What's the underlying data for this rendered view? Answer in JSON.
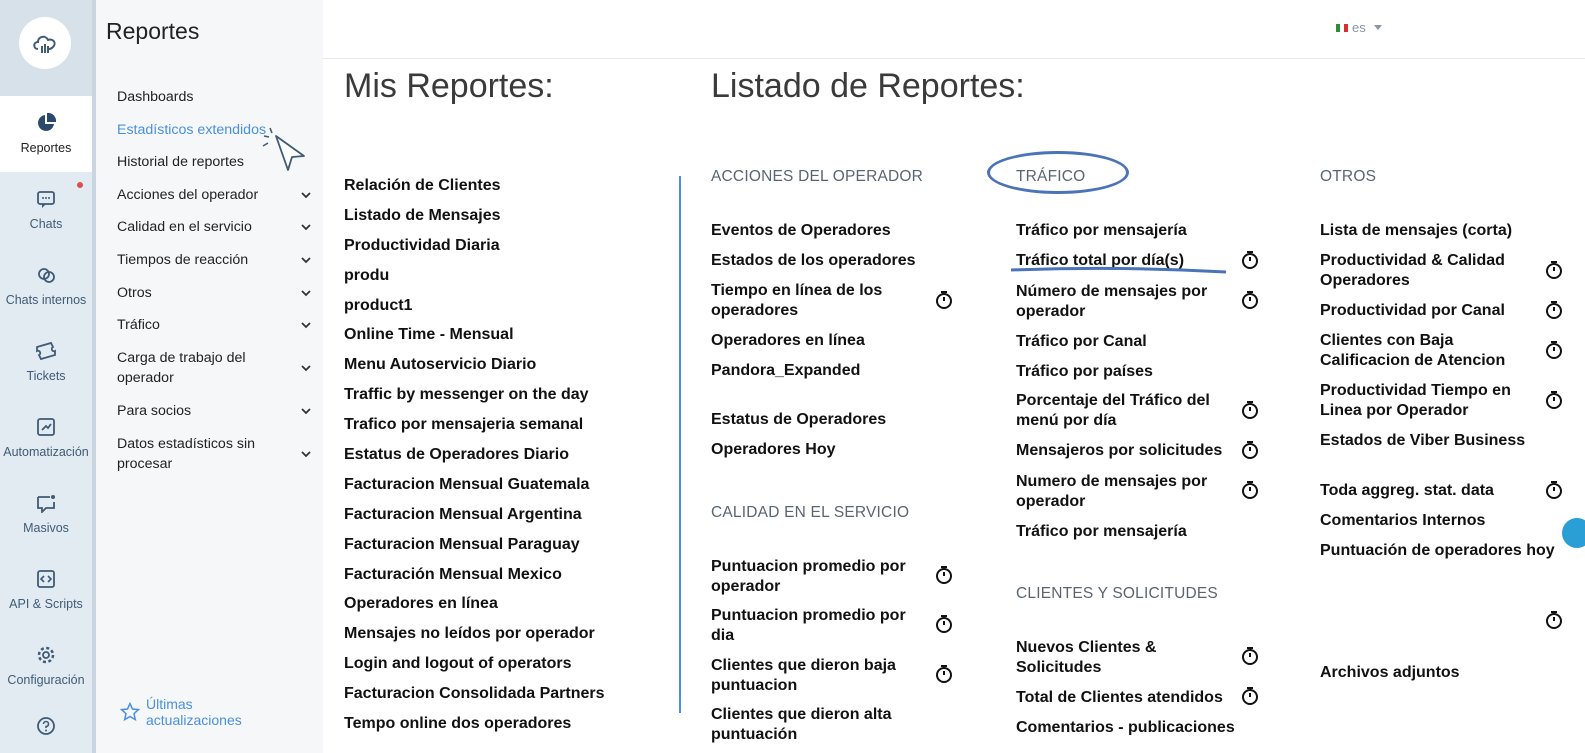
{
  "rail": {
    "items": [
      {
        "label": "Reportes",
        "icon": "pie-chart-icon"
      },
      {
        "label": "Chats",
        "icon": "chat-icon"
      },
      {
        "label": "Chats internos",
        "icon": "internal-chats-icon"
      },
      {
        "label": "Tickets",
        "icon": "ticket-icon"
      },
      {
        "label": "Automatización",
        "icon": "automation-icon"
      },
      {
        "label": "Masivos",
        "icon": "broadcast-icon"
      },
      {
        "label": "API & Scripts",
        "icon": "code-icon"
      },
      {
        "label": "Configuración",
        "icon": "gear-icon"
      }
    ]
  },
  "sidebar": {
    "title": "Reportes",
    "items": [
      {
        "label": "Dashboards"
      },
      {
        "label": "Estadísticos extendidos"
      },
      {
        "label": "Historial de reportes"
      },
      {
        "label": "Acciones del operador"
      },
      {
        "label": "Calidad en el servicio"
      },
      {
        "label": "Tiempos de reacción"
      },
      {
        "label": "Otros"
      },
      {
        "label": "Tráfico"
      },
      {
        "label": "Carga de trabajo del operador"
      },
      {
        "label": "Para socios"
      },
      {
        "label": "Datos estadísticos sin procesar"
      }
    ],
    "updates_label": "Últimas actualizaciones"
  },
  "header": {
    "language": "es"
  },
  "mis_reportes": {
    "title": "Mis Reportes:",
    "items": [
      "Relación de Clientes",
      "Listado de Mensajes",
      "Productividad Diaria",
      "produ",
      "product1",
      "Online Time - Mensual",
      "Menu Autoservicio Diario",
      "Traffic by messenger on the day",
      "Trafico por mensajeria semanal",
      "Estatus de Operadores Diario",
      "Facturacion Mensual Guatemala",
      "Facturacion Mensual Argentina",
      "Facturacion Mensual Paraguay",
      "Facturación Mensual Mexico",
      "Operadores en línea",
      "Mensajes no leídos por operador",
      "Login and logout of operators",
      "Facturacion Consolidada Partners",
      "Tempo online dos operadores"
    ]
  },
  "listado": {
    "title": "Listado de Reportes:",
    "acciones": {
      "heading": "ACCIONES DEL OPERADOR",
      "items": [
        "Eventos de Operadores",
        "Estados de los operadores",
        "Tiempo en línea de los operadores",
        "Operadores en línea",
        "Pandora_Expanded",
        "Estatus de Operadores",
        "Operadores Hoy"
      ]
    },
    "calidad": {
      "heading": "CALIDAD EN EL SERVICIO",
      "items": [
        "Puntuacion promedio por operador",
        "Puntuacion promedio por dia",
        "Clientes que dieron baja puntuacion",
        "Clientes que dieron alta puntuación"
      ]
    },
    "trafico": {
      "heading": "TRÁFICO",
      "items": [
        "Tráfico por mensajería",
        "Tráfico total por día(s)",
        "Número de mensajes por operador",
        "Tráfico por Canal",
        "Tráfico por países",
        "Porcentaje del Tráfico del menú por día",
        "Mensajeros por solicitudes",
        "Numero de mensajes por operador",
        "Tráfico por mensajería"
      ]
    },
    "clientes": {
      "heading": "CLIENTES Y SOLICITUDES",
      "items": [
        "Nuevos Clientes & Solicitudes",
        "Total de Clientes atendidos",
        "Comentarios - publicaciones"
      ]
    },
    "otros": {
      "heading": "OTROS",
      "items": [
        "Lista de mensajes (corta)",
        "Productividad & Calidad Operadores",
        "Productividad por Canal",
        "Clientes con Baja Calificacion de Atencion",
        "Productividad Tiempo en Linea por Operador",
        "Estados de Viber Business",
        "Toda aggreg. stat. data",
        "Comentarios Internos",
        "Puntuación de operadores hoy",
        "Archivos adjuntos"
      ]
    }
  },
  "colors": {
    "accent": "#4a90e2",
    "annotation": "#4a73b8",
    "rail_bg": "#e3ebf2"
  }
}
